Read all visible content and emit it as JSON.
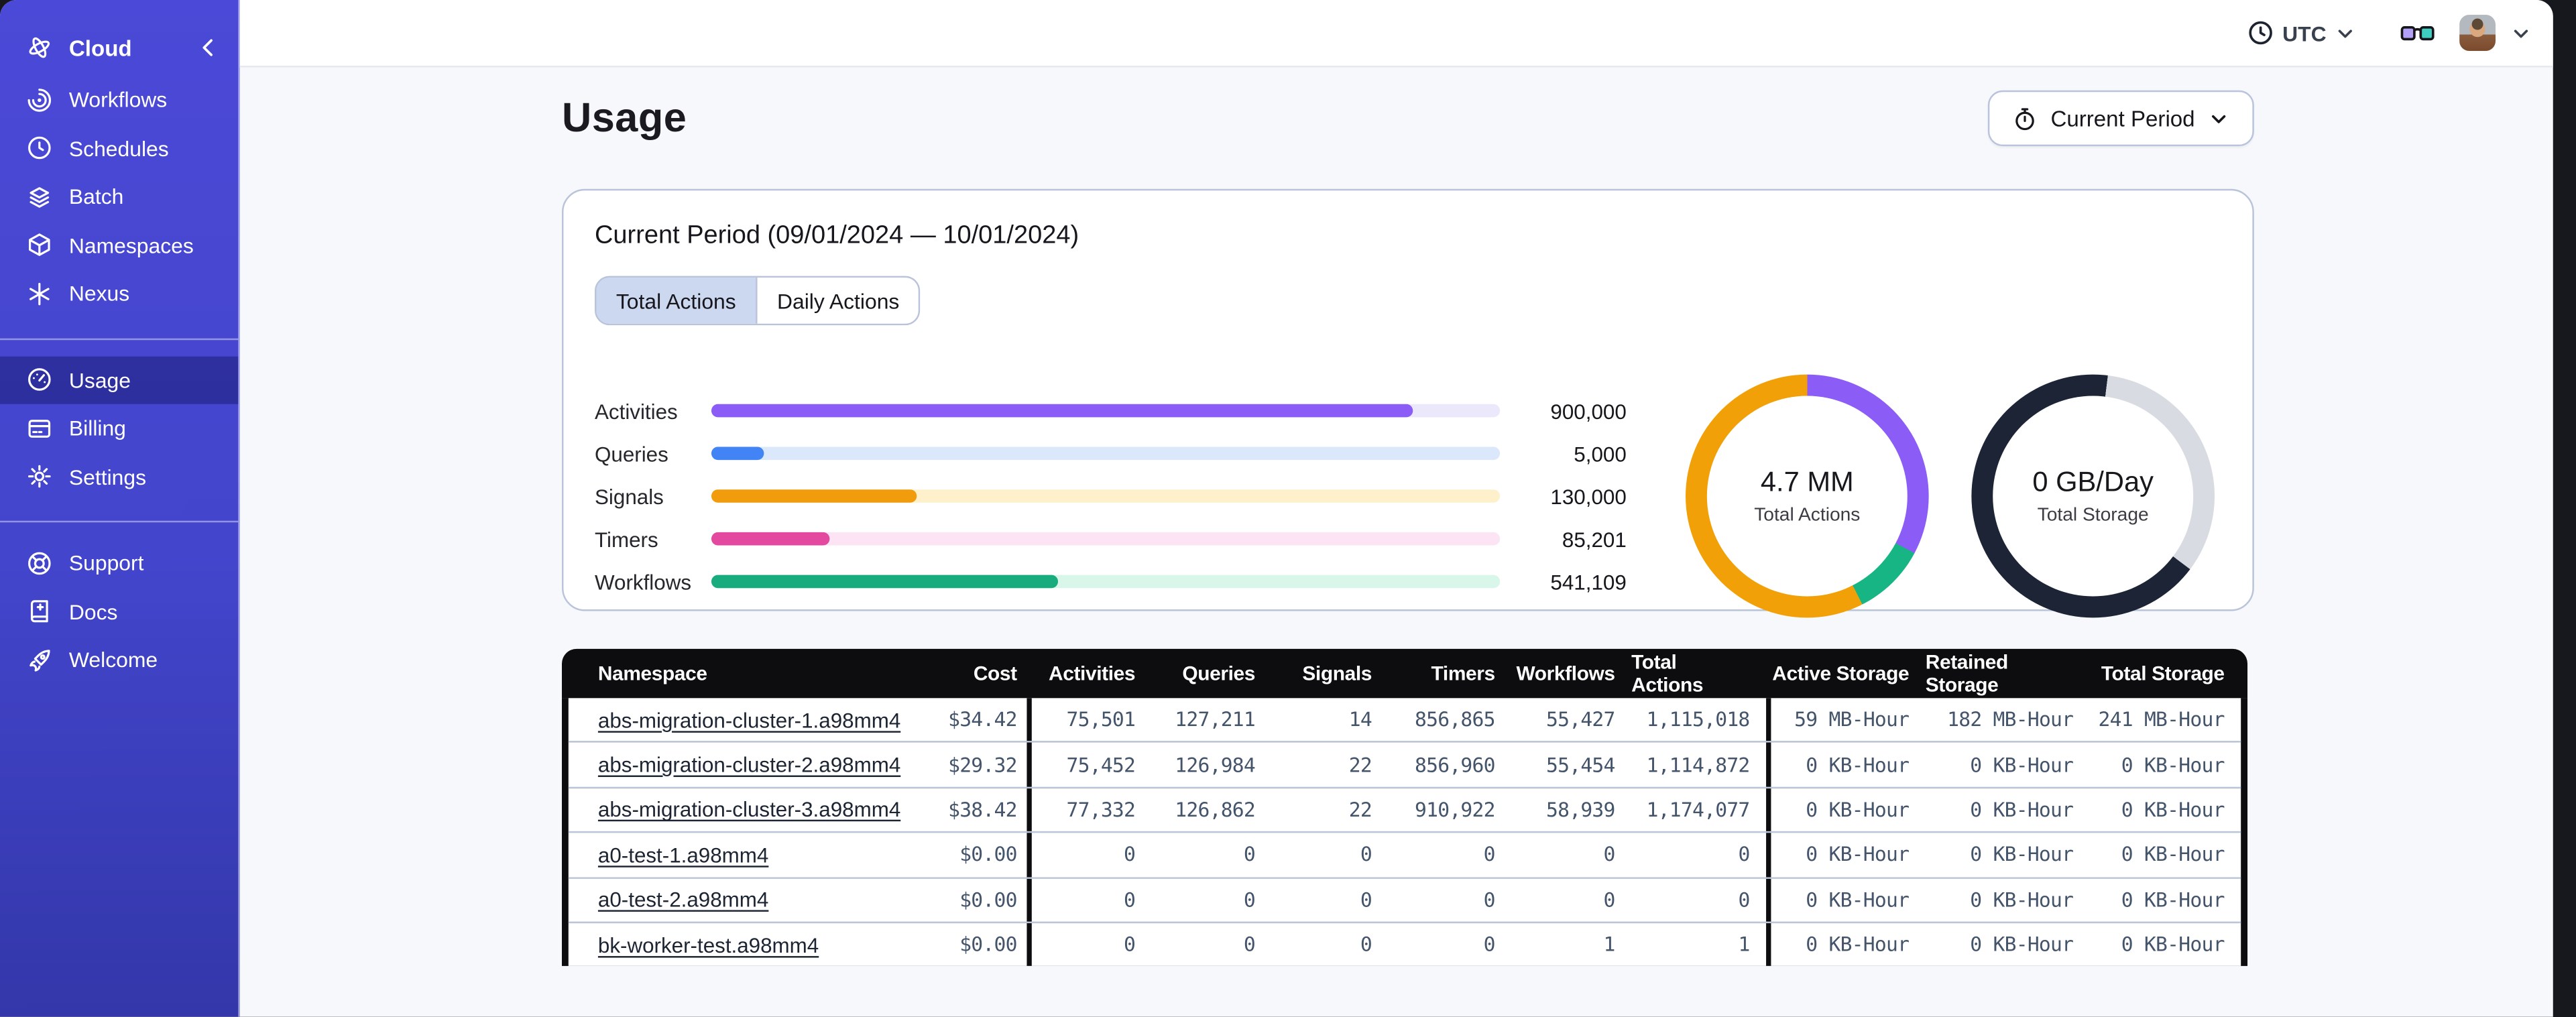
{
  "sidebar": {
    "logo": {
      "label": "Cloud",
      "icon": "temporal-logo"
    },
    "groups": [
      {
        "items": [
          {
            "label": "Workflows",
            "icon": "workflows"
          },
          {
            "label": "Schedules",
            "icon": "schedules"
          },
          {
            "label": "Batch",
            "icon": "batch"
          },
          {
            "label": "Namespaces",
            "icon": "namespaces"
          },
          {
            "label": "Nexus",
            "icon": "nexus"
          }
        ]
      },
      {
        "items": [
          {
            "label": "Usage",
            "icon": "usage",
            "active": true
          },
          {
            "label": "Billing",
            "icon": "billing"
          },
          {
            "label": "Settings",
            "icon": "settings"
          }
        ]
      },
      {
        "items": [
          {
            "label": "Support",
            "icon": "support"
          },
          {
            "label": "Docs",
            "icon": "docs"
          },
          {
            "label": "Welcome",
            "icon": "welcome"
          }
        ]
      }
    ]
  },
  "topbar": {
    "timezone": "UTC"
  },
  "page": {
    "title": "Usage",
    "period_selector": "Current Period"
  },
  "panel": {
    "title": "Current Period (09/01/2024 — 10/01/2024)",
    "tabs": [
      {
        "label": "Total Actions",
        "active": true
      },
      {
        "label": "Daily Actions",
        "active": false
      }
    ]
  },
  "chart_data": {
    "type": "bar",
    "title": "Current Period (09/01/2024 — 10/01/2024)",
    "categories": [
      "Activities",
      "Queries",
      "Signals",
      "Timers",
      "Workflows"
    ],
    "values": [
      900000,
      5000,
      130000,
      85201,
      541109
    ],
    "bars": [
      {
        "label": "Activities",
        "value": 900000,
        "value_label": "900,000",
        "pct": "89%",
        "color": "#8b5cf6",
        "track": "#ece8fc"
      },
      {
        "label": "Queries",
        "value": 5000,
        "value_label": "5,000",
        "pct": "6.7%",
        "color": "#4284f5",
        "track": "#dbe7fb"
      },
      {
        "label": "Signals",
        "value": 130000,
        "value_label": "130,000",
        "pct": "26%",
        "color": "#f09c0c",
        "track": "#fdf0cb"
      },
      {
        "label": "Timers",
        "value": 85201,
        "value_label": "85,201",
        "pct": "15%",
        "color": "#e2499f",
        "track": "#fce4f4"
      },
      {
        "label": "Workflows",
        "value": 541109,
        "value_label": "541,109",
        "pct": "44%",
        "color": "#17ab7e",
        "track": "#d8f6e9"
      }
    ],
    "donuts": [
      {
        "value": "4.7 MM",
        "label": "Total Actions",
        "segments": [
          {
            "color": "#8b5cf6",
            "to_deg": 118
          },
          {
            "color": "#16b583",
            "to_deg": 153
          },
          {
            "color": "#f2a007",
            "to_deg": 360
          }
        ],
        "css_gradient": "conic-gradient(#8b5cf6 0deg 118deg,#16b583 118deg 153deg,#f2a007 153deg 360deg)"
      },
      {
        "value": "0 GB/Day",
        "label": "Total Storage",
        "segments": [
          {
            "color": "#1c2436",
            "to_deg": 7
          },
          {
            "color": "#d8dbe1",
            "to_deg": 127
          },
          {
            "color": "#1c2436",
            "to_deg": 360
          }
        ],
        "css_gradient": "conic-gradient(#1c2436 0deg 7deg,#d8dbe1 7deg 127deg,#1c2436 127deg 360deg)"
      }
    ]
  },
  "table": {
    "columns": [
      "Namespace",
      "Cost",
      "Activities",
      "Queries",
      "Signals",
      "Timers",
      "Workflows",
      "Total Actions",
      "Active Storage",
      "Retained Storage",
      "Total Storage"
    ],
    "rows": [
      {
        "namespace": "abs-migration-cluster-1.a98mm4",
        "cost": "$34.42",
        "activities": "75,501",
        "queries": "127,211",
        "signals": "14",
        "timers": "856,865",
        "workflows": "55,427",
        "total_actions": "1,115,018",
        "active_storage": "59 MB-Hour",
        "retained_storage": "182 MB-Hour",
        "total_storage": "241 MB-Hour"
      },
      {
        "namespace": "abs-migration-cluster-2.a98mm4",
        "cost": "$29.32",
        "activities": "75,452",
        "queries": "126,984",
        "signals": "22",
        "timers": "856,960",
        "workflows": "55,454",
        "total_actions": "1,114,872",
        "active_storage": "0 KB-Hour",
        "retained_storage": "0 KB-Hour",
        "total_storage": "0 KB-Hour"
      },
      {
        "namespace": "abs-migration-cluster-3.a98mm4",
        "cost": "$38.42",
        "activities": "77,332",
        "queries": "126,862",
        "signals": "22",
        "timers": "910,922",
        "workflows": "58,939",
        "total_actions": "1,174,077",
        "active_storage": "0 KB-Hour",
        "retained_storage": "0 KB-Hour",
        "total_storage": "0 KB-Hour"
      },
      {
        "namespace": "a0-test-1.a98mm4",
        "cost": "$0.00",
        "activities": "0",
        "queries": "0",
        "signals": "0",
        "timers": "0",
        "workflows": "0",
        "total_actions": "0",
        "active_storage": "0 KB-Hour",
        "retained_storage": "0 KB-Hour",
        "total_storage": "0 KB-Hour"
      },
      {
        "namespace": "a0-test-2.a98mm4",
        "cost": "$0.00",
        "activities": "0",
        "queries": "0",
        "signals": "0",
        "timers": "0",
        "workflows": "0",
        "total_actions": "0",
        "active_storage": "0 KB-Hour",
        "retained_storage": "0 KB-Hour",
        "total_storage": "0 KB-Hour"
      },
      {
        "namespace": "bk-worker-test.a98mm4",
        "cost": "$0.00",
        "activities": "0",
        "queries": "0",
        "signals": "0",
        "timers": "0",
        "workflows": "1",
        "total_actions": "1",
        "active_storage": "0 KB-Hour",
        "retained_storage": "0 KB-Hour",
        "total_storage": "0 KB-Hour"
      }
    ]
  }
}
